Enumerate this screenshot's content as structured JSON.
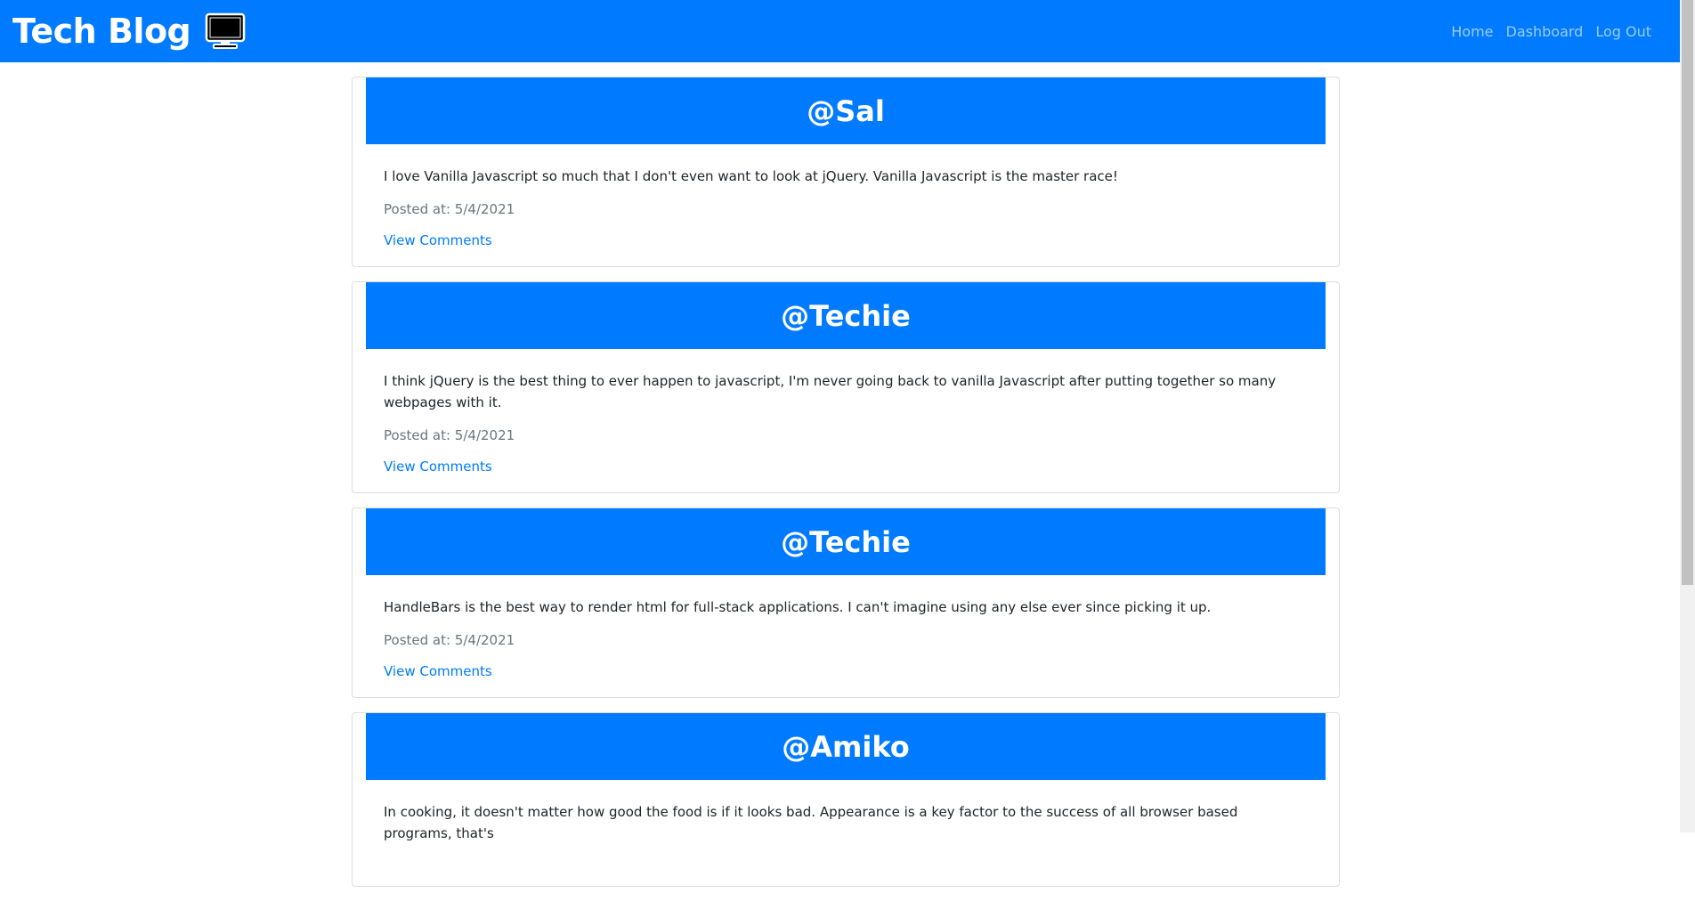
{
  "navbar": {
    "brand": "Tech Blog",
    "brand_icon": "monitor-icon",
    "links": [
      {
        "label": "Home"
      },
      {
        "label": "Dashboard"
      },
      {
        "label": "Log Out"
      }
    ]
  },
  "colors": {
    "primary": "#007bff",
    "text": "#212529",
    "muted": "#6c757d"
  },
  "posts": [
    {
      "author": "@Sal",
      "text": "I love Vanilla Javascript so much that I don't even want to look at jQuery. Vanilla Javascript is the master race!",
      "posted": "Posted at: 5/4/2021",
      "link": "View Comments"
    },
    {
      "author": "@Techie",
      "text": "I think jQuery is the best thing to ever happen to javascript, I'm never going back to vanilla Javascript after putting together so many webpages with it.",
      "posted": "Posted at: 5/4/2021",
      "link": "View Comments"
    },
    {
      "author": "@Techie",
      "text": "HandleBars is the best way to render html for full-stack applications. I can't imagine using any else ever since picking it up.",
      "posted": "Posted at: 5/4/2021",
      "link": "View Comments"
    },
    {
      "author": "@Amiko",
      "text": "In cooking, it doesn't matter how good the food is if it looks bad. Appearance is a key factor to the success of all browser based programs, that's",
      "posted": "",
      "link": ""
    }
  ]
}
